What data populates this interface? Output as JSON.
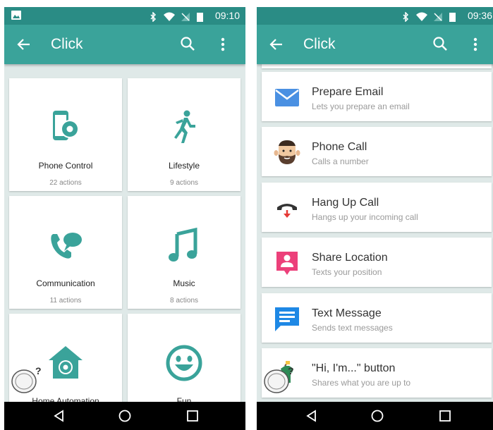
{
  "left_screen": {
    "status_time": "09:10",
    "title": "Click",
    "categories": [
      {
        "name": "Phone Control",
        "count": "22 actions",
        "icon": "phone-settings-icon"
      },
      {
        "name": "Lifestyle",
        "count": "9 actions",
        "icon": "runner-icon"
      },
      {
        "name": "Communication",
        "count": "11 actions",
        "icon": "phone-chat-icon"
      },
      {
        "name": "Music",
        "count": "8 actions",
        "icon": "music-note-icon"
      },
      {
        "name": "Home Automation",
        "count": "",
        "icon": "home-gear-icon"
      },
      {
        "name": "Fun",
        "count": "",
        "icon": "smiley-icon"
      }
    ]
  },
  "right_screen": {
    "status_time": "09:36",
    "title": "Click",
    "actions": [
      {
        "title": "Prepare Email",
        "subtitle": "Lets you prepare an email",
        "icon": "envelope-icon"
      },
      {
        "title": "Phone Call",
        "subtitle": "Calls a number",
        "icon": "bearded-face-icon"
      },
      {
        "title": "Hang Up Call",
        "subtitle": "Hangs up your incoming call",
        "icon": "hang-up-icon"
      },
      {
        "title": "Share Location",
        "subtitle": "Texts your position",
        "icon": "location-pin-icon"
      },
      {
        "title": "Text Message",
        "subtitle": "Sends text messages",
        "icon": "message-bubble-icon"
      },
      {
        "title": "\"Hi, I'm...\" button",
        "subtitle": "Shares what you are up to",
        "icon": "tag-shirt-icon"
      }
    ]
  },
  "colors": {
    "status_bar": "#2a8c85",
    "toolbar": "#3aa39a",
    "accent": "#3aa39a",
    "background": "#dfe9e8"
  }
}
